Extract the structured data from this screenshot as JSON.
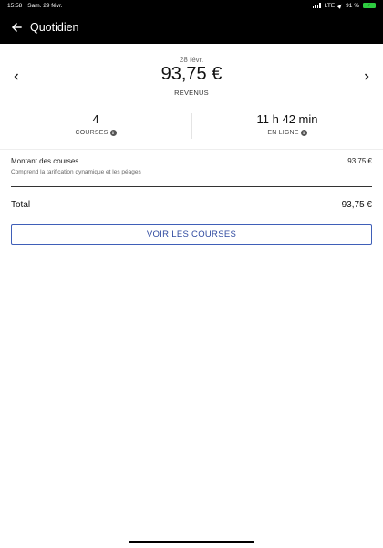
{
  "status_bar": {
    "time": "15:58",
    "date": "Sam. 29 févr.",
    "network": "LTE",
    "battery_percent": "91 %",
    "battery_level": 0.91
  },
  "header": {
    "title": "Quotidien",
    "back_icon": "arrow-left-icon"
  },
  "summary": {
    "date": "28 févr.",
    "amount": "93,75 €",
    "amount_label": "REVENUS",
    "prev_icon": "chevron-left-icon",
    "next_icon": "chevron-right-icon"
  },
  "stats": {
    "courses_value": "4",
    "courses_label": "COURSES",
    "online_value": "11 h 42 min",
    "online_label": "EN LIGNE",
    "info_icon": "info-icon"
  },
  "breakdown": {
    "title": "Montant des courses",
    "value": "93,75 €",
    "note": "Comprend la tarification dynamique et les péages"
  },
  "total": {
    "label": "Total",
    "value": "93,75 €"
  },
  "actions": {
    "voir_courses": "VOIR LES COURSES"
  },
  "colors": {
    "header_bg": "#000000",
    "button_accent": "#3f5fb8",
    "battery": "#2ecc40"
  }
}
